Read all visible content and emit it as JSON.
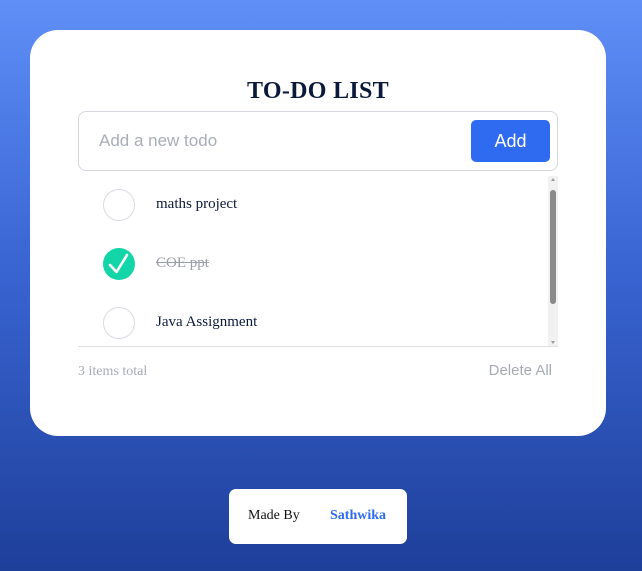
{
  "app": {
    "title": "TO-DO LIST"
  },
  "new_todo": {
    "placeholder": "Add a new todo",
    "value": "",
    "add_label": "Add"
  },
  "todos": [
    {
      "text": "maths project",
      "completed": false
    },
    {
      "text": "COE ppt",
      "completed": true
    },
    {
      "text": "Java Assignment",
      "completed": false
    }
  ],
  "footer": {
    "count_text": "3 items total",
    "delete_all_label": "Delete All"
  },
  "credit": {
    "made_by_label": "Made By",
    "author": "Sathwika"
  },
  "colors": {
    "accent": "#2f6bf0",
    "completed_check": "#12d5a8",
    "title_text": "#0b1a3a",
    "muted_text": "#a6aab3",
    "background_top": "#5f8ff7",
    "background_bottom": "#1e3f9a"
  },
  "icons": {
    "completed": "check-icon",
    "scroll_up": "scroll-up-arrow-icon",
    "scroll_down": "scroll-down-arrow-icon"
  }
}
